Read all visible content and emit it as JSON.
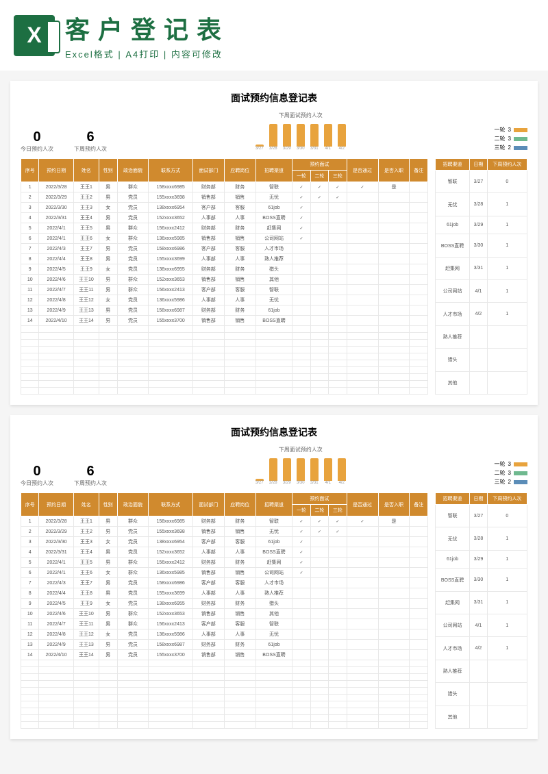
{
  "header": {
    "big_title": "客户登记表",
    "sub_title": "Excel格式 | A4打印 | 内容可修改"
  },
  "sheet": {
    "title": "面试预约信息登记表",
    "stats": {
      "today_num": "0",
      "today_label": "今日预约人次",
      "week_num": "6",
      "week_label": "下周预约人次"
    },
    "chart_title": "下周面试预约人次",
    "legend": {
      "r1_label": "一轮",
      "r1_val": "3",
      "r2_label": "二轮",
      "r2_val": "3",
      "r3_label": "三轮",
      "r3_val": "2"
    },
    "headers": {
      "seq": "序号",
      "date": "预约日期",
      "name": "姓名",
      "gender": "性别",
      "politics": "政治面貌",
      "phone": "联系方式",
      "dept": "面试部门",
      "position": "应聘岗位",
      "channel": "招聘渠道",
      "interview": "预约面试",
      "r1": "一轮",
      "r2": "二轮",
      "r3": "三轮",
      "pass": "是否通过",
      "hire": "是否入职",
      "remark": "备注"
    },
    "rows": [
      {
        "seq": "1",
        "date": "2022/3/28",
        "name": "王王1",
        "gender": "男",
        "politics": "群众",
        "phone": "158xxxx6985",
        "dept": "财务部",
        "position": "财务",
        "channel": "智联",
        "r1": "✓",
        "r2": "✓",
        "r3": "✓",
        "pass": "✓",
        "hire": "是"
      },
      {
        "seq": "2",
        "date": "2022/3/29",
        "name": "王王2",
        "gender": "男",
        "politics": "党员",
        "phone": "155xxxx3698",
        "dept": "销售部",
        "position": "销售",
        "channel": "无忧",
        "r1": "✓",
        "r2": "✓",
        "r3": "✓",
        "pass": "",
        "hire": ""
      },
      {
        "seq": "3",
        "date": "2022/3/30",
        "name": "王王3",
        "gender": "女",
        "politics": "党员",
        "phone": "138xxxx6954",
        "dept": "客户部",
        "position": "客服",
        "channel": "61job",
        "r1": "✓",
        "r2": "",
        "r3": "",
        "pass": "",
        "hire": ""
      },
      {
        "seq": "4",
        "date": "2022/3/31",
        "name": "王王4",
        "gender": "男",
        "politics": "党员",
        "phone": "152xxxx3652",
        "dept": "人事部",
        "position": "人事",
        "channel": "BOSS直聘",
        "r1": "✓",
        "r2": "",
        "r3": "",
        "pass": "",
        "hire": ""
      },
      {
        "seq": "5",
        "date": "2022/4/1",
        "name": "王王5",
        "gender": "男",
        "politics": "群众",
        "phone": "156xxxx2412",
        "dept": "财务部",
        "position": "财务",
        "channel": "赶集网",
        "r1": "✓",
        "r2": "",
        "r3": "",
        "pass": "",
        "hire": ""
      },
      {
        "seq": "6",
        "date": "2022/4/1",
        "name": "王王6",
        "gender": "女",
        "politics": "群众",
        "phone": "136xxxx5985",
        "dept": "销售部",
        "position": "销售",
        "channel": "公司网站",
        "r1": "✓",
        "r2": "",
        "r3": "",
        "pass": "",
        "hire": ""
      },
      {
        "seq": "7",
        "date": "2022/4/3",
        "name": "王王7",
        "gender": "男",
        "politics": "党员",
        "phone": "158xxxx6986",
        "dept": "客户部",
        "position": "客服",
        "channel": "人才市场",
        "r1": "",
        "r2": "",
        "r3": "",
        "pass": "",
        "hire": ""
      },
      {
        "seq": "8",
        "date": "2022/4/4",
        "name": "王王8",
        "gender": "男",
        "politics": "党员",
        "phone": "155xxxx3699",
        "dept": "人事部",
        "position": "人事",
        "channel": "熟人推荐",
        "r1": "",
        "r2": "",
        "r3": "",
        "pass": "",
        "hire": ""
      },
      {
        "seq": "9",
        "date": "2022/4/5",
        "name": "王王9",
        "gender": "女",
        "politics": "党员",
        "phone": "138xxxx6955",
        "dept": "财务部",
        "position": "财务",
        "channel": "猎头",
        "r1": "",
        "r2": "",
        "r3": "",
        "pass": "",
        "hire": ""
      },
      {
        "seq": "10",
        "date": "2022/4/6",
        "name": "王王10",
        "gender": "男",
        "politics": "群众",
        "phone": "152xxxx3653",
        "dept": "销售部",
        "position": "销售",
        "channel": "其他",
        "r1": "",
        "r2": "",
        "r3": "",
        "pass": "",
        "hire": ""
      },
      {
        "seq": "11",
        "date": "2022/4/7",
        "name": "王王11",
        "gender": "男",
        "politics": "群众",
        "phone": "156xxxx2413",
        "dept": "客户部",
        "position": "客服",
        "channel": "智联",
        "r1": "",
        "r2": "",
        "r3": "",
        "pass": "",
        "hire": ""
      },
      {
        "seq": "12",
        "date": "2022/4/8",
        "name": "王王12",
        "gender": "女",
        "politics": "党员",
        "phone": "136xxxx5986",
        "dept": "人事部",
        "position": "人事",
        "channel": "无忧",
        "r1": "",
        "r2": "",
        "r3": "",
        "pass": "",
        "hire": ""
      },
      {
        "seq": "13",
        "date": "2022/4/9",
        "name": "王王13",
        "gender": "男",
        "politics": "党员",
        "phone": "158xxxx6987",
        "dept": "财务部",
        "position": "财务",
        "channel": "61job",
        "r1": "",
        "r2": "",
        "r3": "",
        "pass": "",
        "hire": ""
      },
      {
        "seq": "14",
        "date": "2022/4/10",
        "name": "王王14",
        "gender": "男",
        "politics": "党员",
        "phone": "155xxxx3700",
        "dept": "销售部",
        "position": "销售",
        "channel": "BOSS直聘",
        "r1": "",
        "r2": "",
        "r3": "",
        "pass": "",
        "hire": ""
      }
    ],
    "side_headers": {
      "channel": "招聘渠道",
      "date": "日期",
      "count": "下周预约人次"
    },
    "side_rows": [
      {
        "channel": "智联",
        "date": "3/27",
        "count": "0"
      },
      {
        "channel": "无忧",
        "date": "3/28",
        "count": "1"
      },
      {
        "channel": "61job",
        "date": "3/29",
        "count": "1"
      },
      {
        "channel": "BOSS直聘",
        "date": "3/30",
        "count": "1"
      },
      {
        "channel": "赶集网",
        "date": "3/31",
        "count": "1"
      },
      {
        "channel": "公司网站",
        "date": "4/1",
        "count": "1"
      },
      {
        "channel": "人才市场",
        "date": "4/2",
        "count": "1"
      },
      {
        "channel": "熟人推荐",
        "date": "",
        "count": ""
      },
      {
        "channel": "猎头",
        "date": "",
        "count": ""
      },
      {
        "channel": "其他",
        "date": "",
        "count": ""
      }
    ]
  },
  "chart_data": {
    "type": "bar",
    "title": "下周面试预约人次",
    "categories": [
      "3/27",
      "3/28",
      "3/29",
      "3/30",
      "3/31",
      "4/1",
      "4/2"
    ],
    "values": [
      0,
      1,
      1,
      1,
      1,
      1,
      1
    ],
    "ylim": [
      0,
      2
    ],
    "legend_series": [
      {
        "name": "一轮",
        "value": 3,
        "color": "#e8a33d"
      },
      {
        "name": "二轮",
        "value": 3,
        "color": "#6fb98f"
      },
      {
        "name": "三轮",
        "value": 2,
        "color": "#5b8db8"
      }
    ]
  }
}
